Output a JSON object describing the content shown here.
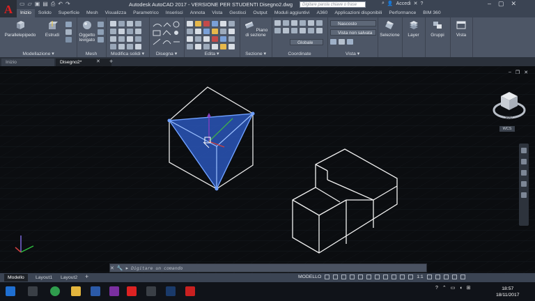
{
  "window": {
    "title": "Autodesk AutoCAD 2017 - VERSIONE PER STUDENTI   Disegno2.dwg",
    "search_placeholder": "Digitare parola chiave o frase",
    "sign_in": "Accedi"
  },
  "ribbon_tabs": [
    "Inizio",
    "Solido",
    "Superficie",
    "Mesh",
    "Visualizza",
    "Parametrico",
    "Inserisci",
    "Annota",
    "Vista",
    "Gestisci",
    "Output",
    "Moduli aggiuntivi",
    "A360",
    "Applicazioni disponibili",
    "Performance",
    "BIM 360"
  ],
  "ribbon": {
    "buttons": {
      "parallelepipedo": "Parallelepipedo",
      "estrudi": "Estrudi",
      "oggetto_levigato": "Oggetto levigato",
      "piano_sezione": "Piano di sezione",
      "selezione": "Selezione",
      "layer": "Layer",
      "gruppi": "Gruppi",
      "vista": "Vista"
    },
    "panels": {
      "modellazione": "Modellazione ▾",
      "mesh": "Mesh",
      "modifica_solidi": "Modifica solidi ▾",
      "disegna": "Disegna ▾",
      "edita": "Edita ▾",
      "sezione": "Sezione ▾",
      "coordinate": "Coordinate",
      "vista": "Vista ▾"
    },
    "dropdowns": {
      "visual_style": "Nascosto",
      "view": "Vista non salvata",
      "ucs": "Globale"
    }
  },
  "doc_tabs": [
    "Inizio",
    "Disegno2*"
  ],
  "viewcube": {
    "face_label": "SUD",
    "wcs_label": "WCS"
  },
  "command_line": {
    "placeholder": "Digitare un comando"
  },
  "layout_tabs": [
    "Modello",
    "Layout1",
    "Layout2"
  ],
  "status": {
    "space": "MODELLO",
    "scale": "1:1"
  },
  "clock": {
    "time": "18:57",
    "date": "18/11/2017"
  },
  "colors": {
    "ribbon": "#4d5666",
    "canvas": "#0b0d10",
    "selection": "#2f5fcf",
    "accent": "#e02020"
  }
}
